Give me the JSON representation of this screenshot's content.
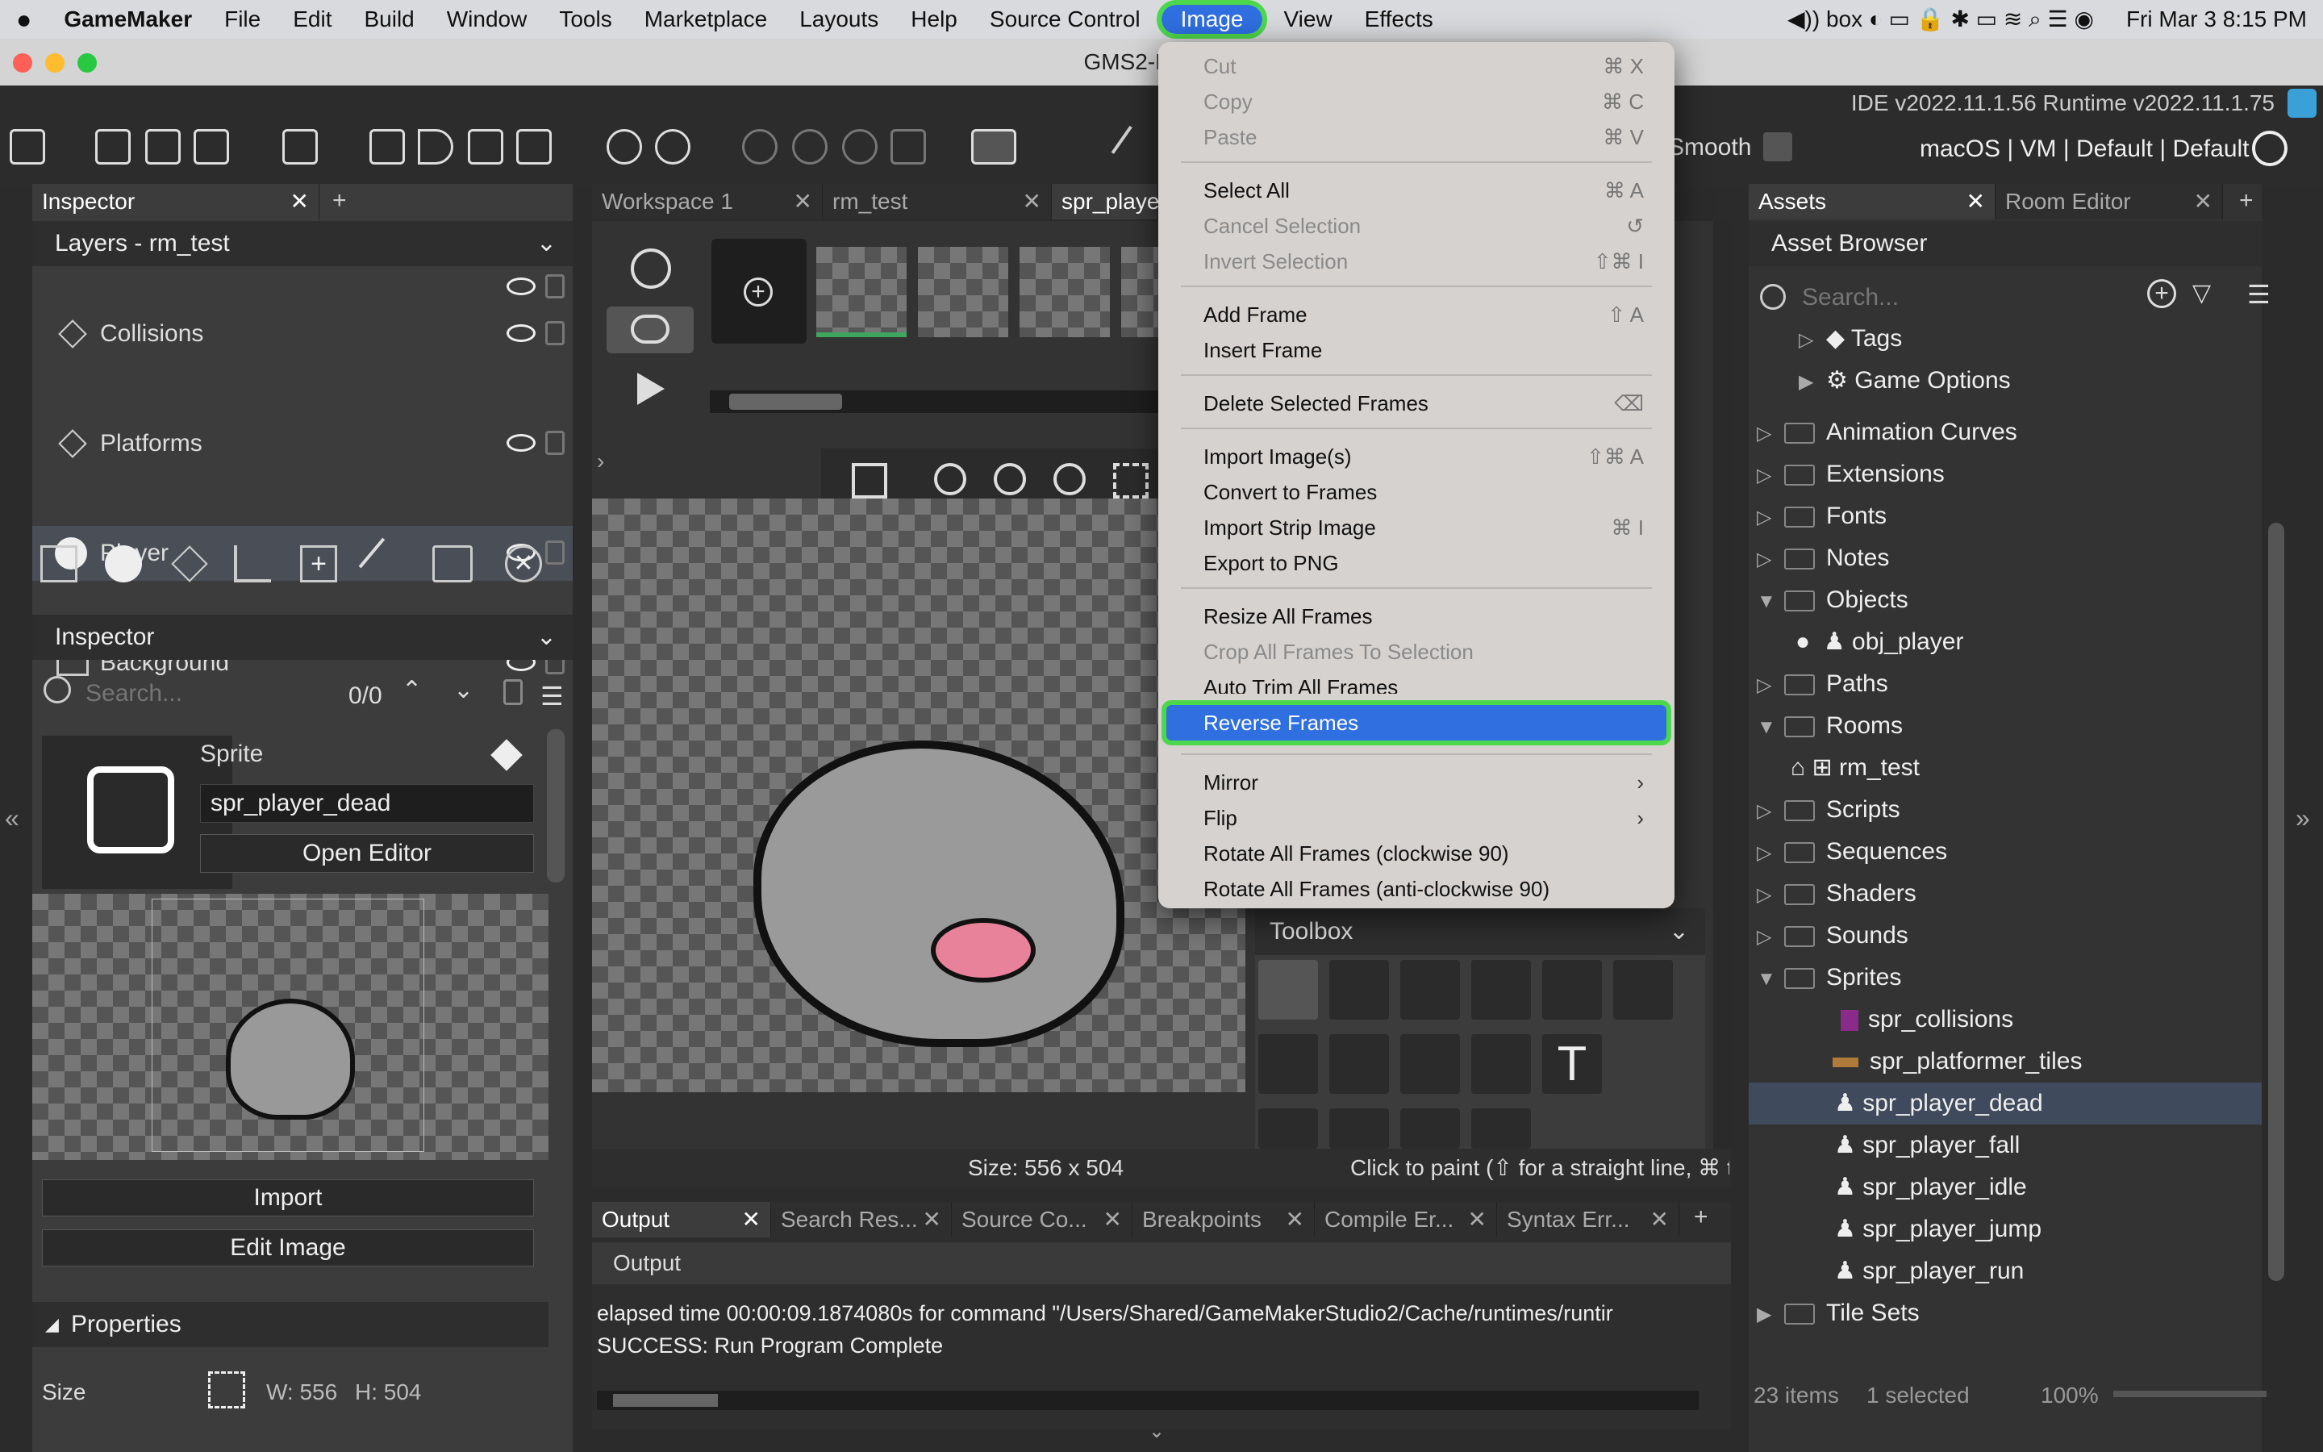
{
  "menubar": {
    "apple": "",
    "app": "GameMaker",
    "items": [
      "File",
      "Edit",
      "Build",
      "Window",
      "Tools",
      "Marketplace",
      "Layouts",
      "Help",
      "Source Control",
      "Image",
      "View",
      "Effects"
    ],
    "clock": "Fri Mar 3  8:15 PM"
  },
  "window": {
    "title": "GMS2-Platform"
  },
  "version": "IDE v2022.11.1.56  Runtime v2022.11.1.75",
  "target": "macOS | VM | Default | Default",
  "smooth_label": "Smooth",
  "left_panel": {
    "tab": "Inspector",
    "layers_header": "Layers - rm_test",
    "layers": [
      "Collisions",
      "Platforms",
      "Player",
      "Background"
    ],
    "inspector_header": "Inspector",
    "search_placeholder": "Search...",
    "search_count": "0/0",
    "sprite_label": "Sprite",
    "sprite_name": "spr_player_dead",
    "open_editor": "Open Editor",
    "import": "Import",
    "edit_image": "Edit Image",
    "properties": "Properties",
    "size_label": "Size",
    "size_w": "W: 556",
    "size_h": "H: 504"
  },
  "center": {
    "tabs": [
      "Workspace 1",
      "rm_test",
      "spr_playe"
    ],
    "size_status": "Size: 556 x 504",
    "paint_hint": "Click to paint (⇧ for a straight line, ⌘ t",
    "toolbox": "Toolbox"
  },
  "output": {
    "tabs": [
      "Output",
      "Search Res...",
      "Source Co...",
      "Breakpoints",
      "Compile Er...",
      "Syntax Err..."
    ],
    "header": "Output",
    "lines": [
      "elapsed time 00:00:09.1874080s for command \"/Users/Shared/GameMakerStudio2/Cache/runtimes/runtir",
      "SUCCESS: Run Program Complete"
    ]
  },
  "menu": {
    "items": [
      {
        "label": "Cut",
        "sc": "⌘ X",
        "dis": true
      },
      {
        "label": "Copy",
        "sc": "⌘ C",
        "dis": true
      },
      {
        "label": "Paste",
        "sc": "⌘ V",
        "dis": true
      },
      {
        "label": "Select All",
        "sc": "⌘ A",
        "dis": false
      },
      {
        "label": "Cancel Selection",
        "sc": "↺",
        "dis": true
      },
      {
        "label": "Invert Selection",
        "sc": "⇧⌘ I",
        "dis": true
      },
      {
        "label": "Add Frame",
        "sc": "⇧ A",
        "dis": false
      },
      {
        "label": "Insert Frame",
        "sc": "",
        "dis": false
      },
      {
        "label": "Delete Selected Frames",
        "sc": "⌫",
        "dis": false
      },
      {
        "label": "Import Image(s)",
        "sc": "⇧⌘ A",
        "dis": false
      },
      {
        "label": "Convert to Frames",
        "sc": "",
        "dis": false
      },
      {
        "label": "Import Strip Image",
        "sc": "⌘ I",
        "dis": false
      },
      {
        "label": "Export to PNG",
        "sc": "",
        "dis": false
      },
      {
        "label": "Resize All Frames",
        "sc": "",
        "dis": false
      },
      {
        "label": "Crop All Frames To Selection",
        "sc": "",
        "dis": true
      },
      {
        "label": "Auto Trim All Frames",
        "sc": "",
        "dis": false
      },
      {
        "label": "Reverse Frames",
        "sc": "",
        "dis": false
      },
      {
        "label": "Mirror",
        "sc": "",
        "dis": false
      },
      {
        "label": "Flip",
        "sc": "",
        "dis": false
      },
      {
        "label": "Rotate All Frames (clockwise 90)",
        "sc": "",
        "dis": false
      },
      {
        "label": "Rotate All Frames (anti-clockwise 90)",
        "sc": "",
        "dis": false
      }
    ]
  },
  "assets": {
    "tabs": [
      "Assets",
      "Room Editor"
    ],
    "header": "Asset Browser",
    "search_placeholder": "Search...",
    "tree": [
      "Tags",
      "Game Options",
      "Animation Curves",
      "Extensions",
      "Fonts",
      "Notes",
      "Objects",
      "obj_player",
      "Paths",
      "Rooms",
      "rm_test",
      "Scripts",
      "Sequences",
      "Shaders",
      "Sounds",
      "Sprites",
      "spr_collisions",
      "spr_platformer_tiles",
      "spr_player_dead",
      "spr_player_fall",
      "spr_player_idle",
      "spr_player_jump",
      "spr_player_run",
      "Tile Sets"
    ],
    "status_items": "23 items",
    "status_sel": "1 selected",
    "zoom": "100%"
  },
  "colors": {
    "accent": "#2f6fe0",
    "highlight": "#4cd84c"
  }
}
